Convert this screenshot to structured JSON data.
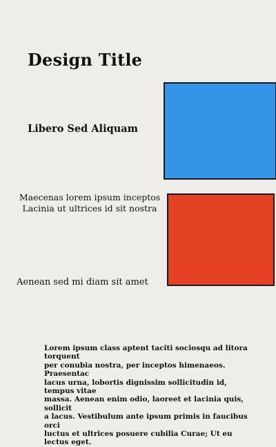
{
  "title": "Design Title",
  "subtitle": "Libero Sed Aliquam",
  "caption_lines": [
    "Maecenas lorem ipsum inceptos",
    "Lacinia ut ultrices id sit nostra"
  ],
  "caption_single": "Aenean sed mi diam sit amet",
  "body_lines": [
    "Lorem ipsum class aptent taciti sociosqu ad litora torquent",
    "per conubia nostra, per inceptos himenaeos. Praesentac",
    "lacus urna, lobortis dignissim sollicitudin id, tempus vitae",
    "massa. Aenean enim odio, laoreet et lacinia quis, sollicit",
    "a lacus. Vestibulum ante ipsum primis in faucibus orci",
    "luctus et ultrices posuere cubilia Curae; Ut eu lectus eget."
  ],
  "colors": {
    "background": "#efedea",
    "blue_block": "#3593e8",
    "red_block": "#e44125"
  }
}
